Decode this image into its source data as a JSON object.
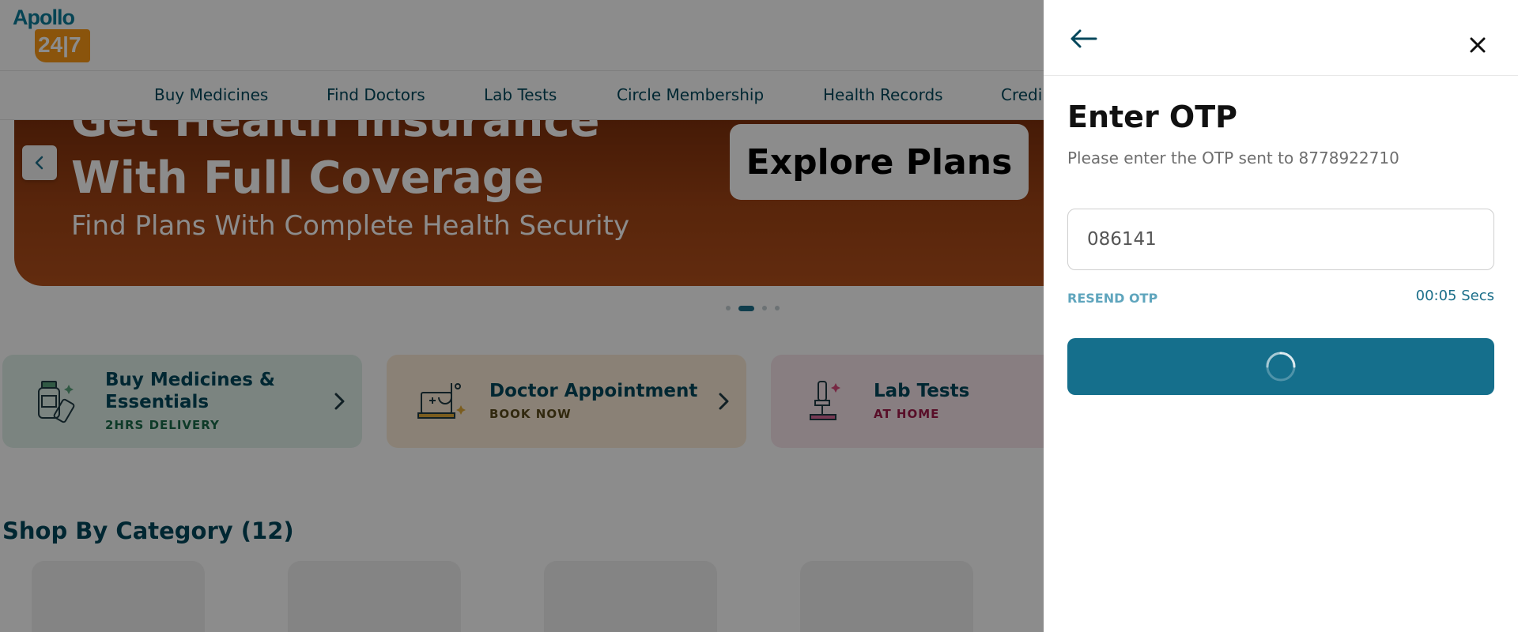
{
  "brand": {
    "name": "Apollo",
    "number": "24|7",
    "accent": "#0b7c9a",
    "orange": "#fc9916"
  },
  "nav": {
    "items": [
      "Buy Medicines",
      "Find Doctors",
      "Lab Tests",
      "Circle Membership",
      "Health Records",
      "Credi"
    ]
  },
  "banner": {
    "title_top": "Get Health Insurance",
    "title": "With Full Coverage",
    "subtitle": "Find Plans With Complete Health Security",
    "cta": "Explore Plans",
    "slides_total": 4,
    "slide_active": 2
  },
  "cards": [
    {
      "title_line1": "Buy Medicines &",
      "title_line2": "Essentials",
      "subtitle": "2HRS DELIVERY",
      "subtitle_color": "#1a6b4a",
      "icon": "medicine-bottle-icon"
    },
    {
      "title_line1": "Doctor Appointment",
      "title_line2": "",
      "subtitle": "BOOK NOW",
      "subtitle_color": "#5a4a1a",
      "icon": "laptop-stethoscope-icon"
    },
    {
      "title_line1": "Lab Tests",
      "title_line2": "",
      "subtitle": "AT HOME",
      "subtitle_color": "#a01a4a",
      "icon": "microscope-icon"
    }
  ],
  "section": {
    "title": "Shop By Category (12)"
  },
  "otp": {
    "title": "Enter OTP",
    "description": "Please enter the OTP sent to 8778922710",
    "value": "086141",
    "resend_label": "RESEND OTP",
    "timer": "00:05 Secs",
    "back_icon": "arrow-left-icon",
    "close_icon": "close-icon",
    "button_state": "loading",
    "button_color": "#156f8c"
  }
}
